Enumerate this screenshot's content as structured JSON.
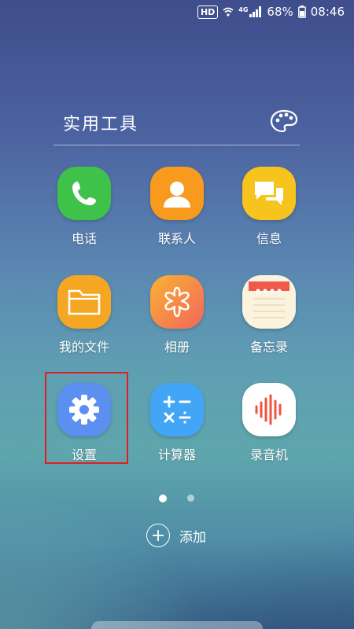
{
  "status_bar": {
    "hd": "HD",
    "network": "4G",
    "battery": "68%",
    "time": "08:46"
  },
  "folder": {
    "title": "实用工具",
    "apps": [
      {
        "label": "电话",
        "icon": "phone-icon",
        "color": "#3fc24a"
      },
      {
        "label": "联系人",
        "icon": "contacts-icon",
        "color": "#f79a1e"
      },
      {
        "label": "信息",
        "icon": "messages-icon",
        "color": "#f6c41c"
      },
      {
        "label": "我的文件",
        "icon": "folder-icon",
        "color": "#f5a623"
      },
      {
        "label": "相册",
        "icon": "gallery-icon",
        "color": "#f7884b"
      },
      {
        "label": "备忘录",
        "icon": "notes-icon",
        "color": "#fbf3de"
      },
      {
        "label": "设置",
        "icon": "gear-icon",
        "color": "#5b8ff0"
      },
      {
        "label": "计算器",
        "icon": "calculator-icon",
        "color": "#42a5f5"
      },
      {
        "label": "录音机",
        "icon": "recorder-icon",
        "color": "#ffffff"
      }
    ]
  },
  "add_button": {
    "label": "添加"
  },
  "highlight_color": "#e02020"
}
